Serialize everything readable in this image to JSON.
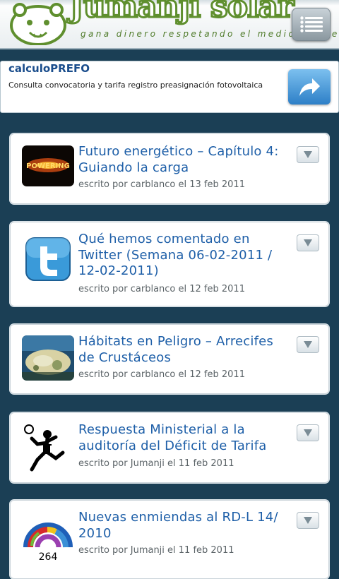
{
  "header": {
    "logo_title": "Jumanji solar",
    "logo_tagline": "gana dinero respetando el medio ambiente",
    "menu_icon": "list-menu-icon"
  },
  "banner": {
    "title": "calculoPREFO",
    "description": "Consulta convocatoria y tarifa registro preasignación fotovoltaica",
    "action_icon": "share-arrow-icon"
  },
  "articles": [
    {
      "title": "Futuro energético – Capítulo 4: Guiando la carga",
      "meta": "escrito por carblanco el 13 feb 2011",
      "thumb_label": "POWERING"
    },
    {
      "title": "Qué hemos comentado en Twitter (Semana 06-02-2011 / 12-02-2011)",
      "meta": "escrito por carblanco el 12 feb 2011"
    },
    {
      "title": "Hábitats en Peligro – Arrecifes de Crustáceos",
      "meta": "escrito por carblanco el 12 feb 2011"
    },
    {
      "title": "Respuesta Ministerial a la auditoría del Déficit de Tarifa",
      "meta": "escrito por Jumanji el 11 feb 2011"
    },
    {
      "title": "Nuevas enmiendas al RD-L 14/ 2010",
      "meta": "escrito por Jumanji el 11 feb 2011",
      "thumb_label": "264"
    }
  ]
}
